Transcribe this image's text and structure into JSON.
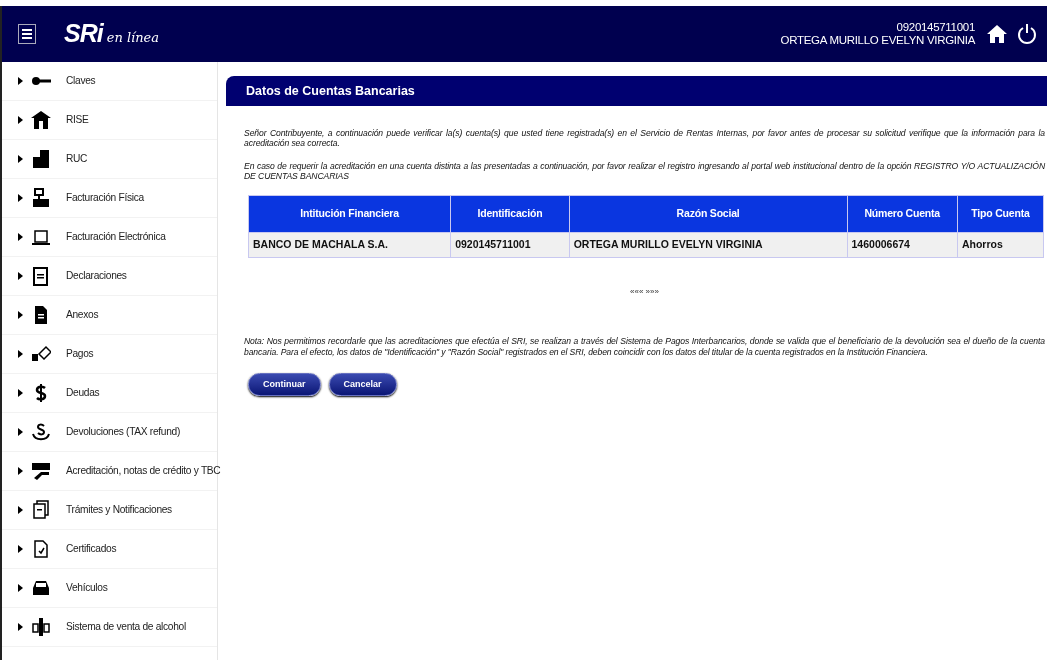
{
  "header": {
    "logo": "SRi",
    "logo_tagline": "en línea",
    "user_id": "0920145711001",
    "user_name": "ORTEGA MURILLO EVELYN VIRGINIA"
  },
  "sidebar": {
    "items": [
      {
        "label": "Claves"
      },
      {
        "label": "RISE"
      },
      {
        "label": "RUC"
      },
      {
        "label": "Facturación Física"
      },
      {
        "label": "Facturación Electrónica"
      },
      {
        "label": "Declaraciones"
      },
      {
        "label": "Anexos"
      },
      {
        "label": "Pagos"
      },
      {
        "label": "Deudas"
      },
      {
        "label": "Devoluciones (TAX refund)"
      },
      {
        "label": "Acreditación, notas de crédito y TBC"
      },
      {
        "label": "Trámites y Notificaciones"
      },
      {
        "label": "Certificados"
      },
      {
        "label": "Vehículos"
      },
      {
        "label": "Sistema de venta de alcohol"
      }
    ]
  },
  "panel": {
    "title": "Datos de Cuentas Bancarias",
    "paragraphs": [
      "Señor Contribuyente, a continuación puede verificar la(s) cuenta(s) que usted tiene registrada(s) en el Servicio de Rentas Internas, por favor antes de procesar su solicitud verifique que la información para la acreditación sea correcta.",
      "En caso de requerir la acreditación en una cuenta distinta a las presentadas a continuación, por favor realizar el registro ingresando al portal web institucional dentro de la opción REGISTRO Y/O ACTUALIZACIÓN DE CUENTAS BANCARIAS"
    ],
    "table": {
      "columns": [
        "Intitución Financiera",
        "Identificación",
        "Razón Social",
        "Número Cuenta",
        "Tipo Cuenta"
      ],
      "rows": [
        [
          "BANCO DE MACHALA S.A.",
          "0920145711001",
          "ORTEGA MURILLO EVELYN VIRGINIA",
          "1460006674",
          "Ahorros"
        ]
      ]
    },
    "pager": "««« »»»",
    "note": "Nota: Nos permitimos recordarle que las acreditaciones que efectúa el SRI, se realizan a través del Sistema de Pagos Interbancarios, donde se valida que el beneficiario de la devolución sea el dueño de la cuenta bancaria. Para el efecto, los datos de \"Identificación\" y \"Razón Social\" registrados en el SRI, deben coincidir con los datos del titular de la cuenta registrados en la Institución Financiera.",
    "buttons": [
      "Continuar",
      "Cancelar"
    ]
  }
}
